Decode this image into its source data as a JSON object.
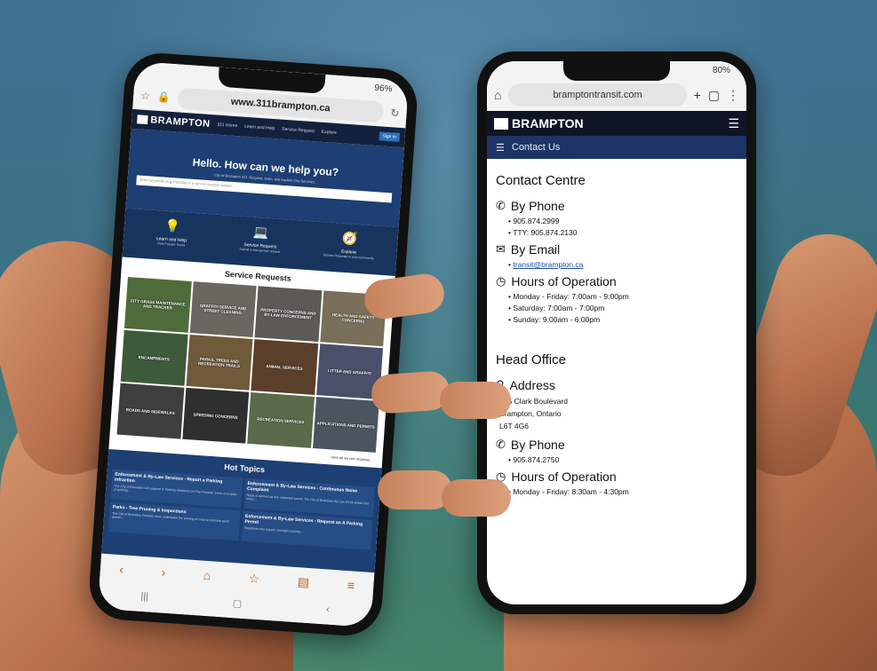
{
  "left_phone": {
    "status": {
      "battery": "96%"
    },
    "url": "www.311brampton.ca",
    "site": {
      "logo": "BRAMPTON",
      "nav": [
        "311 Home",
        "Learn and Help",
        "Service Request",
        "Explore"
      ],
      "sign_in": "Sign in"
    },
    "hero": {
      "title": "Hello. How can we help you?",
      "subtitle": "City of Brampton 311. Request, learn, and explore City Services.",
      "search_placeholder": "Enter keywords (e.g. Pothole) or a service request number"
    },
    "quick": [
      {
        "icon": "lightbulb-icon",
        "label": "Learn and Help",
        "sub": "View Popular Topics"
      },
      {
        "icon": "laptop-icon",
        "label": "Service Request",
        "sub": "Submit a new service request"
      },
      {
        "icon": "compass-icon",
        "label": "Explore",
        "sub": "Service Requests in your community"
      }
    ],
    "service_requests_title": "Service Requests",
    "tiles": [
      {
        "label": "CITY GRASS MAINTENANCE AND TRACKER",
        "color": "#4f6b3a"
      },
      {
        "label": "GRAFFITI SERVICE AND STREET CLEANING",
        "color": "#6b6660"
      },
      {
        "label": "PROPERTY CONCERNS AND BY-LAW ENFORCEMENT",
        "color": "#5c5a55"
      },
      {
        "label": "HEALTH AND SAFETY CONCERNS",
        "color": "#7a6f5a"
      },
      {
        "label": "ENCAMPMENTS",
        "color": "#3d5a3a"
      },
      {
        "label": "PARKS, TREES AND RECREATION TRAILS",
        "color": "#6f5a3a"
      },
      {
        "label": "ANIMAL SERVICES",
        "color": "#5a3f2a"
      },
      {
        "label": "LITTER AND GRAFFITI",
        "color": "#4a4f6a"
      },
      {
        "label": "ROADS AND SIDEWALKS",
        "color": "#3f3f3f"
      },
      {
        "label": "SPEEDING CONCERNS",
        "color": "#2f2f2f"
      },
      {
        "label": "RECREATION SERVICES",
        "color": "#5a6a4a"
      },
      {
        "label": "APPLICATIONS AND PERMITS",
        "color": "#4a5560"
      }
    ],
    "view_all": "View all service requests",
    "hot_topics_title": "Hot Topics",
    "hot_topics": [
      {
        "title": "Enforcement & By-Law Services - Report a Parking Infraction",
        "desc": "The City of Brampton will respond to Parking Violations on City Property. Some examples of parking..."
      },
      {
        "title": "Enforcement & By-Law Services - Continuous Noise Complaint",
        "desc": "Noise is defined as any unwanted sound. The City of Brampton By-Law 93-84 states that noise..."
      },
      {
        "title": "Parks - Tree Pruning & Inspections",
        "desc": "The City of Brampton Forestry team undertakes the pruning of trees to promote good growth..."
      },
      {
        "title": "Enforcement & By-Law Services - Request an A Parking Permit",
        "desc": "Residents who require overnight parking..."
      }
    ]
  },
  "right_phone": {
    "status": {
      "battery": "80%"
    },
    "url": "bramptontransit.com",
    "logo": "BRAMPTON",
    "sub_nav_label": "Contact Us",
    "contact_centre": {
      "heading": "Contact Centre",
      "phone_label": "By Phone",
      "phones": [
        "905.874.2999",
        "TTY: 905.874.2130"
      ],
      "email_label": "By Email",
      "email": "transit@brampton.ca",
      "hours_label": "Hours of Operation",
      "hours": [
        "Monday - Friday: 7:00am - 9:00pm",
        "Saturday: 7:00am - 7:00pm",
        "Sunday: 9:00am - 6:00pm"
      ]
    },
    "head_office": {
      "heading": "Head Office",
      "address_label": "Address",
      "address": [
        "185 Clark Boulevard",
        "Brampton, Ontario",
        "L6T 4G6"
      ],
      "phone_label": "By Phone",
      "phones": [
        "905.874.2750"
      ],
      "hours_label": "Hours of Operation",
      "hours": [
        "Monday - Friday: 8:30am - 4:30pm"
      ]
    }
  }
}
